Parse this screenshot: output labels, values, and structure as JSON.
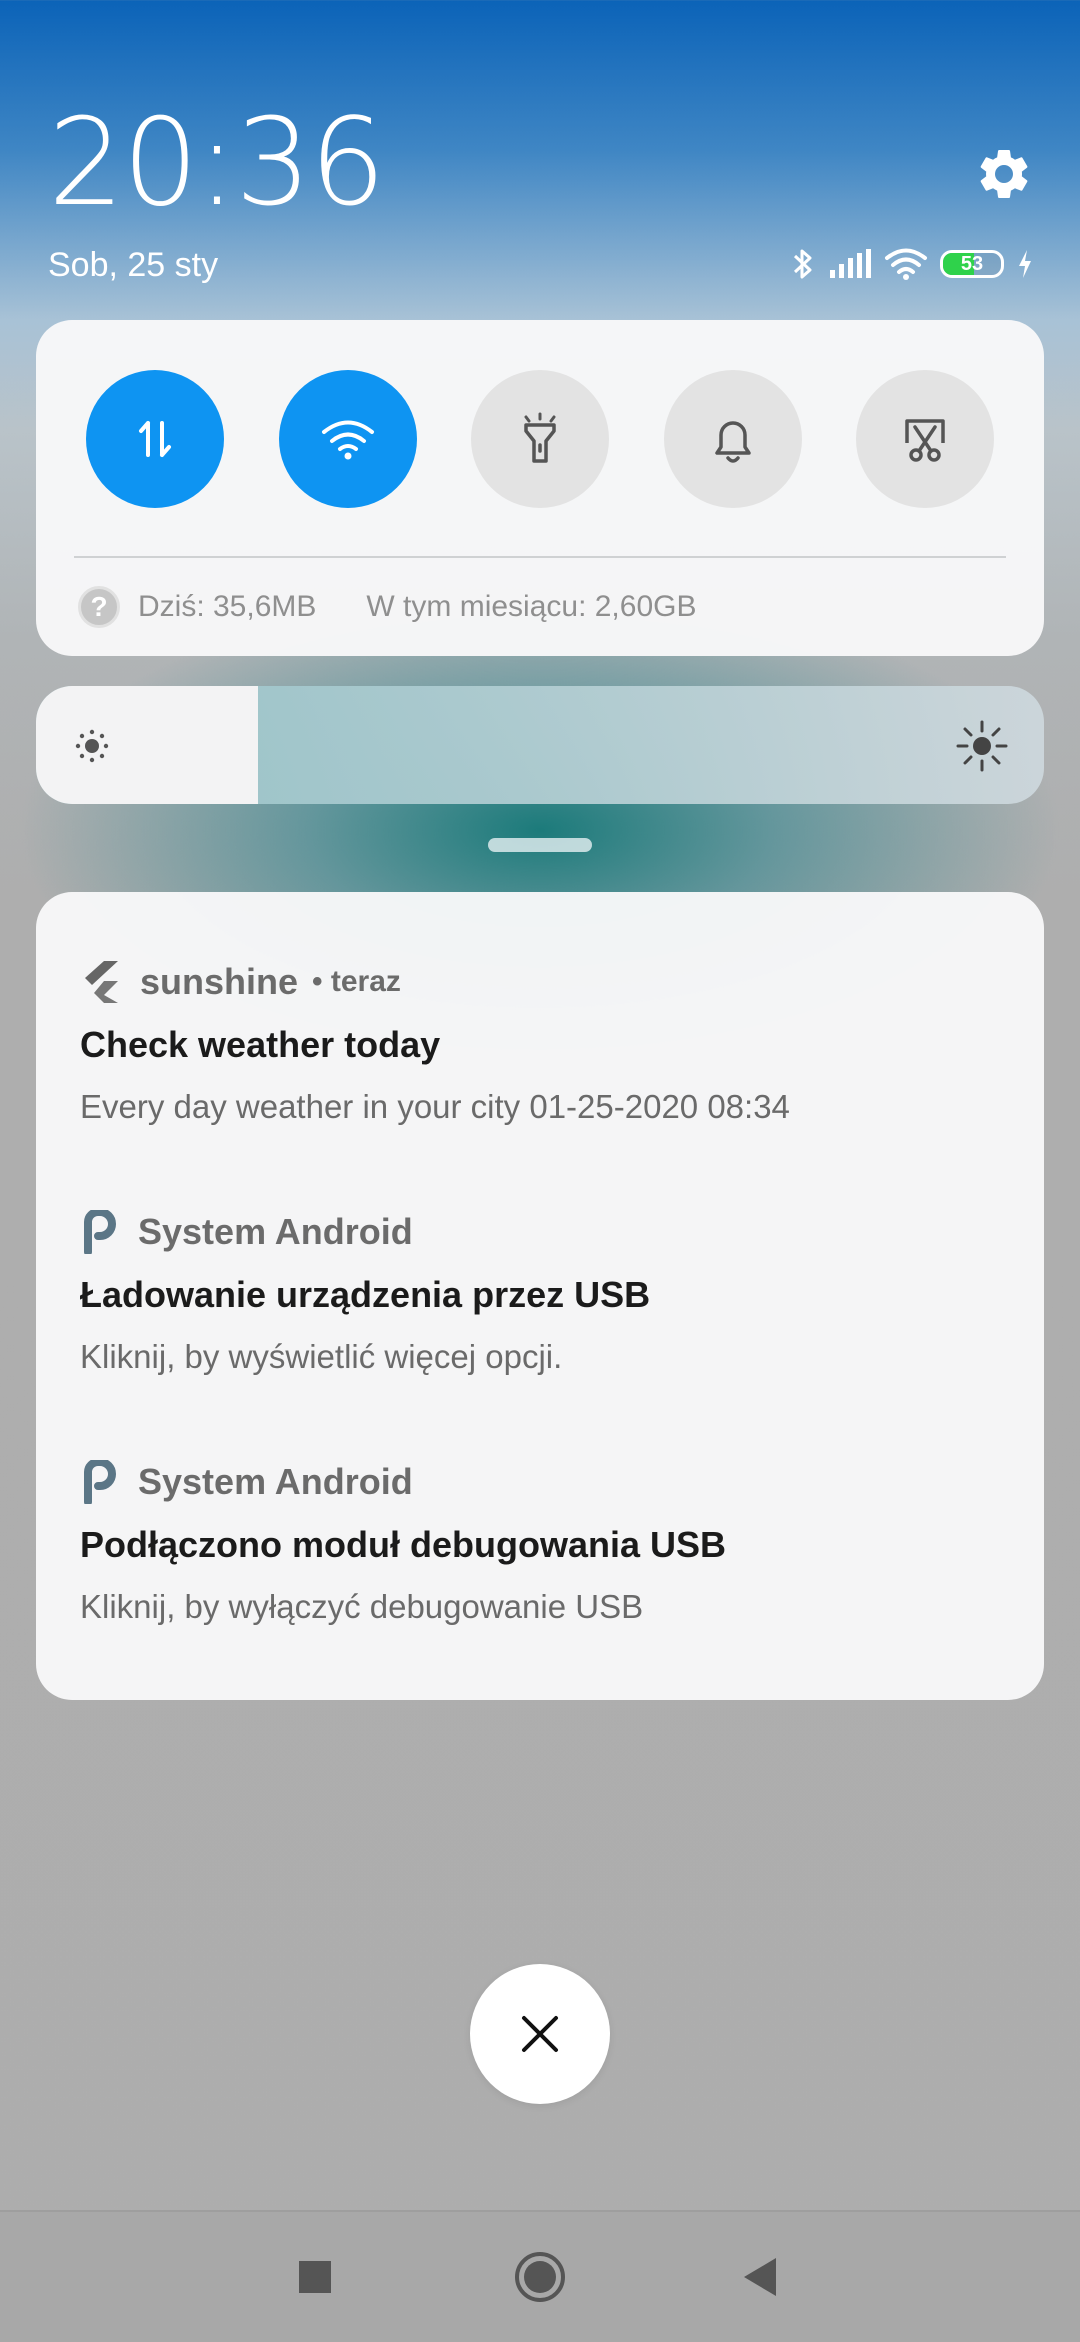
{
  "header": {
    "time": "20:36",
    "date": "Sob, 25 sty"
  },
  "status_bar": {
    "icons": [
      "bluetooth-icon",
      "signal-icon",
      "wifi-icon",
      "battery-icon",
      "charging-icon"
    ],
    "battery_percent": "53",
    "battery_level": 0.53,
    "battery_color": "#2fd24b"
  },
  "quick_settings": {
    "toggles": [
      {
        "name": "mobile-data",
        "icon": "data-arrows-icon",
        "active": true
      },
      {
        "name": "wifi",
        "icon": "wifi-icon",
        "active": true
      },
      {
        "name": "flashlight",
        "icon": "flashlight-icon",
        "active": false
      },
      {
        "name": "sound",
        "icon": "bell-icon",
        "active": false
      },
      {
        "name": "screenshot",
        "icon": "scissors-icon",
        "active": false
      }
    ],
    "active_color": "#0e94f2",
    "help_icon_label": "?",
    "usage_today": "Dziś: 35,6MB",
    "usage_month": "W tym miesiącu: 2,60GB"
  },
  "brightness": {
    "level": 0.22
  },
  "notifications": [
    {
      "app": "sunshine",
      "time": "• teraz",
      "icon": "flutter-icon",
      "title": "Check weather today",
      "body": "Every day weather in your city 01-25-2020 08:34"
    },
    {
      "app": "System Android",
      "icon": "android-system-icon",
      "title": "Ładowanie urządzenia przez USB",
      "body": "Kliknij, by wyświetlić więcej opcji."
    },
    {
      "app": "System Android",
      "icon": "android-system-icon",
      "title": "Podłączono moduł debugowania USB",
      "body": "Kliknij, by wyłączyć debugowanie USB"
    }
  ],
  "navigation": {
    "buttons": [
      "recents-button",
      "home-button",
      "back-button"
    ]
  }
}
